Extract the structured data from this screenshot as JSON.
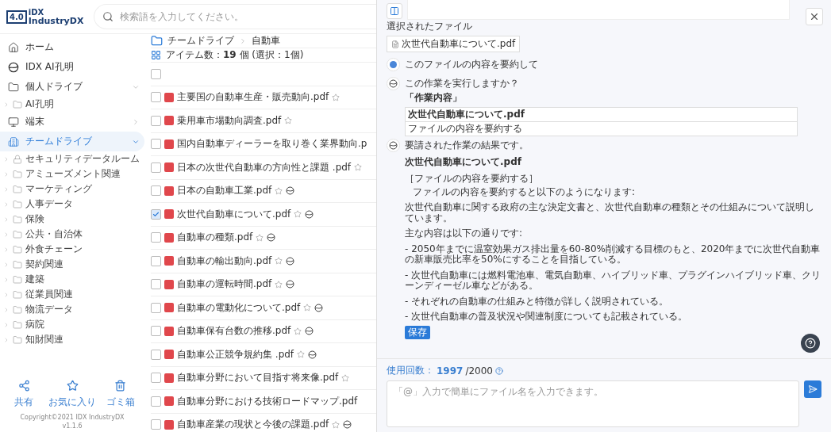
{
  "logo": {
    "badge": "4.0",
    "line1": "iDX",
    "line2": "IndustryDX"
  },
  "search": {
    "placeholder": "検索語を入力してください。"
  },
  "sidebar": {
    "items": [
      {
        "kind": "home",
        "label": "ホーム",
        "selected": false
      },
      {
        "kind": "ai",
        "label": "IDX AI孔明",
        "selected": false
      },
      {
        "kind": "drive",
        "label": "個人ドライブ",
        "selected": false,
        "expanded": true,
        "children": [
          {
            "label": "AI孔明"
          }
        ]
      },
      {
        "kind": "device",
        "label": "端末",
        "selected": false,
        "expanded": false
      },
      {
        "kind": "team",
        "label": "チームドライブ",
        "selected": true,
        "expanded": true,
        "children": [
          {
            "label": "セキュリティデータルーム",
            "locked": true
          },
          {
            "label": "アミューズメント関連",
            "locked": false
          },
          {
            "label": "マーケティング",
            "locked": false
          },
          {
            "label": "人事データ",
            "locked": false
          },
          {
            "label": "保険",
            "locked": false
          },
          {
            "label": "公共・自治体",
            "locked": false
          },
          {
            "label": "外食チェーン",
            "locked": false
          },
          {
            "label": "契約関連",
            "locked": false
          },
          {
            "label": "建築",
            "locked": false
          },
          {
            "label": "従業員関連",
            "locked": false
          },
          {
            "label": "物流データ",
            "locked": false
          },
          {
            "label": "病院",
            "locked": false
          },
          {
            "label": "知財関連",
            "locked": false
          }
        ]
      }
    ],
    "actions": [
      {
        "kind": "share",
        "label": "共有"
      },
      {
        "kind": "favorite",
        "label": "お気に入り"
      },
      {
        "kind": "trash",
        "label": "ゴミ箱"
      }
    ],
    "copyright": "Copyright©2021 IDX IndustryDX",
    "version": "v1.1.6"
  },
  "breadcrumb": [
    "チームドライブ",
    "自動車"
  ],
  "item_count": {
    "label": "アイテム数：",
    "count": "19",
    "unit": "個 (選択：1個)"
  },
  "select_all": {
    "checked": false
  },
  "files": [
    {
      "name": "主要国の自動車生産・販売動向.pdf",
      "checked": false,
      "star": true,
      "ai": false
    },
    {
      "name": "乗用車市場動向調査.pdf",
      "checked": false,
      "star": true,
      "ai": false
    },
    {
      "name": "国内自動車ディーラーを取り巻く業界動向.p",
      "checked": false,
      "star": false,
      "ai": false
    },
    {
      "name": "日本の次世代自動車の方向性と課題 .pdf",
      "checked": false,
      "star": true,
      "ai": false
    },
    {
      "name": "日本の自動車工業.pdf",
      "checked": false,
      "star": true,
      "ai": true
    },
    {
      "name": "次世代自動車について.pdf",
      "checked": true,
      "star": true,
      "ai": true
    },
    {
      "name": "自動車の種類.pdf",
      "checked": false,
      "star": true,
      "ai": true
    },
    {
      "name": "自動車の輸出動向.pdf",
      "checked": false,
      "star": true,
      "ai": true
    },
    {
      "name": "自動車の運転時間.pdf",
      "checked": false,
      "star": true,
      "ai": true
    },
    {
      "name": "自動車の電動化について.pdf",
      "checked": false,
      "star": true,
      "ai": true
    },
    {
      "name": "自動車保有台数の推移.pdf",
      "checked": false,
      "star": true,
      "ai": true
    },
    {
      "name": "自動車公正競争規約集 .pdf",
      "checked": false,
      "star": true,
      "ai": true
    },
    {
      "name": "自動車分野において目指す将来像.pdf",
      "checked": false,
      "star": true,
      "ai": false
    },
    {
      "name": "自動車分野における技術ロードマップ.pdf",
      "checked": false,
      "star": false,
      "ai": false
    },
    {
      "name": "自動車産業の現状と今後の課題.pdf",
      "checked": false,
      "star": true,
      "ai": true
    }
  ],
  "panel": {
    "selected_label": "選択されたファイル",
    "selected_file": "次世代自動車について.pdf",
    "messages": [
      {
        "kind": "user",
        "text": "このファイルの内容を要約して"
      },
      {
        "kind": "confirm",
        "text": "この作業を実行しますか？",
        "heading": "「作業内容」",
        "table": [
          "次世代自動車について.pdf",
          "ファイルの内容を要約する"
        ]
      },
      {
        "kind": "result",
        "text": "要請された作業の結果です。",
        "file": "次世代自動車について.pdf",
        "task": "［ファイルの内容を要約する］",
        "lines": [
          "ファイルの内容を要約すると以下のようになります:",
          "次世代自動車に関する政府の主な決定文書と、次世代自動車の種類とその仕組みについて説明しています。",
          "主な内容は以下の通りです:",
          "- 2050年までに温室効果ガス排出量を60-80%削減する目標のもと、2020年までに次世代自動車の新車販売比率を50%にすることを目指している。",
          "- 次世代自動車には燃料電池車、電気自動車、ハイブリッド車、プラグインハイブリッド車、クリーンディーゼル車などがある。",
          "- それぞれの自動車の仕組みと特徴が詳しく説明されている。",
          "- 次世代自動車の普及状況や関連制度についても記載されている。"
        ],
        "save": "保存"
      }
    ],
    "usage_label": "使用回数：",
    "usage_count": "1997",
    "usage_total": "/2000",
    "input_placeholder": "「@」入力で簡単にファイル名を入力できます。"
  }
}
